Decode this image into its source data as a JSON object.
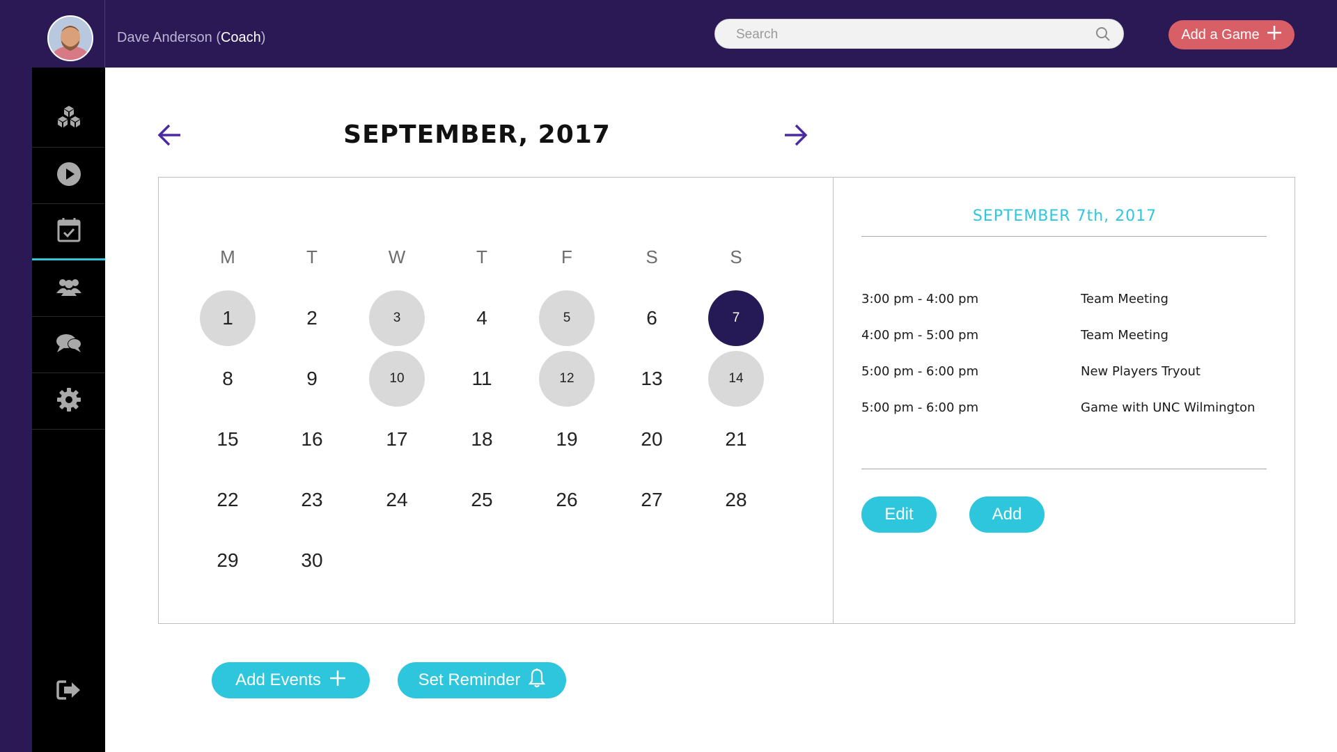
{
  "header": {
    "user_name": "Dave Anderson",
    "user_role": "Coach",
    "search_placeholder": "Search",
    "add_game_label": "Add a Game"
  },
  "sidebar": {
    "items": [
      {
        "icon": "cubes-icon"
      },
      {
        "icon": "play-icon"
      },
      {
        "icon": "calendar-check-icon",
        "active": true
      },
      {
        "icon": "team-icon"
      },
      {
        "icon": "chat-icon"
      },
      {
        "icon": "gear-icon"
      },
      {
        "icon": "logout-icon"
      }
    ]
  },
  "calendar": {
    "month_title": "SEPTEMBER, 2017",
    "weekdays": [
      "M",
      "T",
      "W",
      "T",
      "F",
      "S",
      "S"
    ],
    "days": [
      "1",
      "2",
      "3",
      "4",
      "5",
      "6",
      "7",
      "8",
      "9",
      "10",
      "11",
      "12",
      "13",
      "14",
      "15",
      "16",
      "17",
      "18",
      "19",
      "20",
      "21",
      "22",
      "23",
      "24",
      "25",
      "26",
      "27",
      "28",
      "29",
      "30"
    ],
    "event_days": [
      "1",
      "3",
      "5",
      "10",
      "12",
      "14"
    ],
    "selected_day": "7"
  },
  "details": {
    "date_title": "SEPTEMBER 7th, 2017",
    "events": [
      {
        "time": "3:00 pm - 4:00 pm",
        "name": "Team Meeting"
      },
      {
        "time": "4:00 pm - 5:00 pm",
        "name": "Team Meeting"
      },
      {
        "time": "5:00 pm - 6:00 pm",
        "name": "New Players Tryout"
      },
      {
        "time": "5:00 pm - 6:00 pm",
        "name": "Game with UNC Wilmington"
      }
    ],
    "edit_label": "Edit",
    "add_label": "Add"
  },
  "actions": {
    "add_events_label": "Add Events",
    "set_reminder_label": "Set Reminder"
  },
  "colors": {
    "header_bg": "#2a1955",
    "sidebar_bg": "#000000",
    "accent_cyan": "#2ec6dc",
    "add_game_red": "#d95f66",
    "selected_day": "#251a55",
    "event_day": "#d9d9d9"
  }
}
